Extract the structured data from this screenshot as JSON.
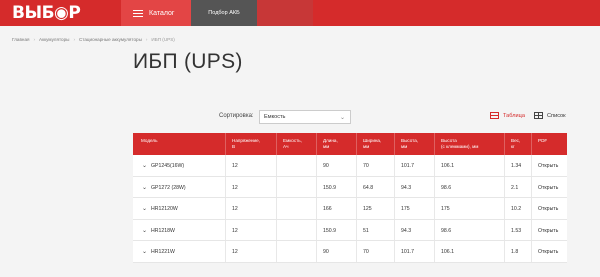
{
  "header": {
    "logo_text": "ВЫБ◉Р",
    "catalog_label": "Каталог",
    "akb_tab": "Подбор АКБ"
  },
  "breadcrumb": [
    "Главная",
    "Аккумуляторы",
    "Стационарные аккумуляторы",
    "ИБП (UPS)"
  ],
  "page": {
    "title": "ИБП (UPS)"
  },
  "sort": {
    "label": "Сортировка:",
    "value": "Емкость"
  },
  "view": {
    "table_label": "Таблица",
    "list_label": "Список"
  },
  "table": {
    "headers": [
      "Модель",
      "Напряжение,\nВ",
      "Емкость,\nАч",
      "Длина,\nмм",
      "Ширина,\nмм",
      "Высота,\nмм",
      "Высота\n(с клеммами), мм",
      "Вес,\nкг",
      "PDF"
    ],
    "rows": [
      {
        "model": "GP1245(16W)",
        "voltage": "12",
        "capacity": "",
        "length": "90",
        "width": "70",
        "height": "101.7",
        "height_terminals": "106.1",
        "weight": "1.34",
        "pdf": "Открыть"
      },
      {
        "model": "GP1272 (28W)",
        "voltage": "12",
        "capacity": "",
        "length": "150.9",
        "width": "64.8",
        "height": "94.3",
        "height_terminals": "98.6",
        "weight": "2.1",
        "pdf": "Открыть"
      },
      {
        "model": "HR12120W",
        "voltage": "12",
        "capacity": "",
        "length": "166",
        "width": "125",
        "height": "175",
        "height_terminals": "175",
        "weight": "10.2",
        "pdf": "Открыть"
      },
      {
        "model": "HR1218W",
        "voltage": "12",
        "capacity": "",
        "length": "150.9",
        "width": "51",
        "height": "94.3",
        "height_terminals": "98.6",
        "weight": "1.53",
        "pdf": "Открыть"
      },
      {
        "model": "HR1221W",
        "voltage": "12",
        "capacity": "",
        "length": "90",
        "width": "70",
        "height": "101.7",
        "height_terminals": "106.1",
        "weight": "1.8",
        "pdf": "Открыть"
      }
    ]
  },
  "colors": {
    "brand_red": "#d52b2b",
    "tab_dark": "#555555",
    "background": "#f4f4f4"
  },
  "icons": {
    "table_view": "table-view-icon",
    "list_view": "list-view-icon",
    "expand": "chevron-down-icon",
    "menu": "burger-icon"
  }
}
